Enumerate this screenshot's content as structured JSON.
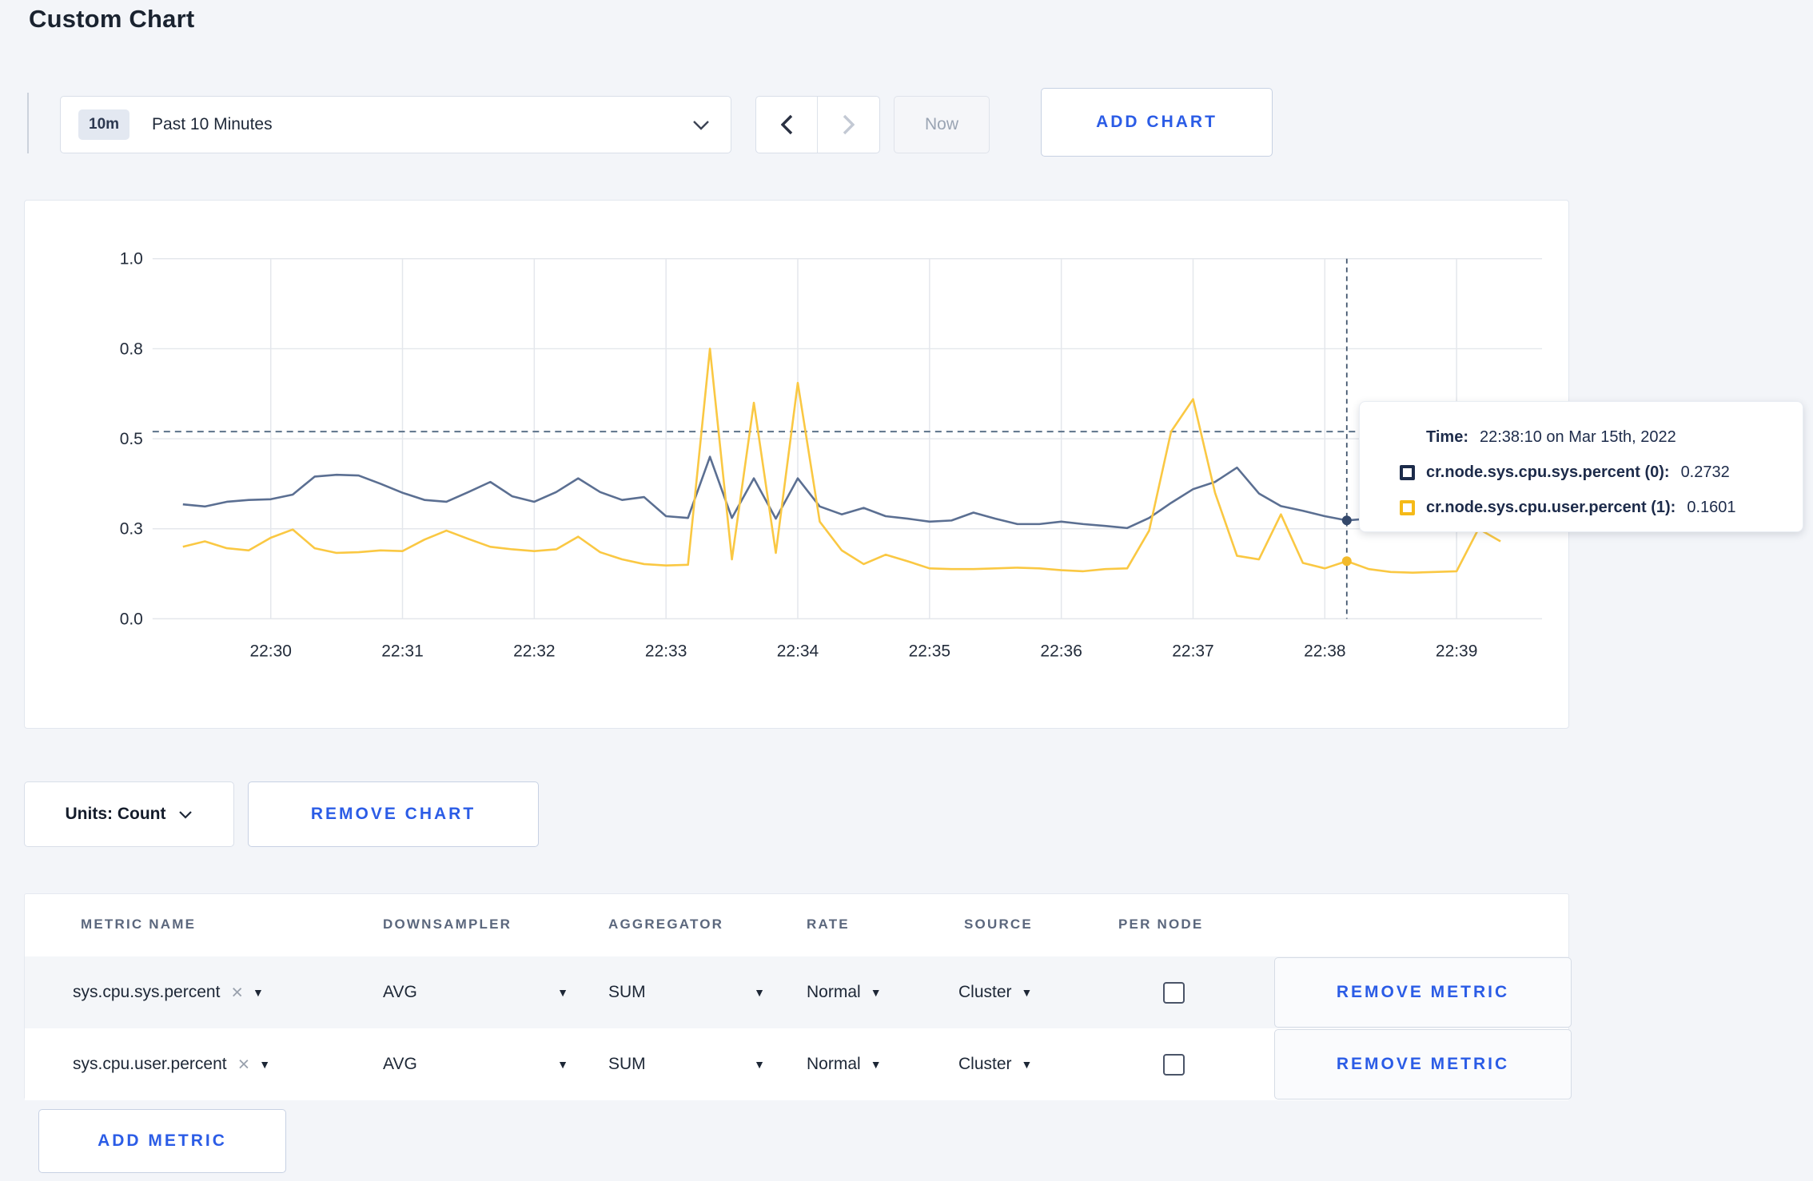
{
  "page": {
    "title": "Custom Chart",
    "background": "#f3f5f9",
    "accent_blue": "#2b5ce6"
  },
  "toolbar": {
    "time_range": {
      "badge": "10m",
      "label": "Past 10 Minutes"
    },
    "now_label": "Now",
    "add_chart_label": "ADD CHART",
    "icons": {
      "prev": "chevron-left",
      "next": "chevron-right",
      "open": "chevron-down"
    },
    "prev_enabled": true,
    "next_enabled": false
  },
  "chart_data": {
    "type": "line",
    "title": "",
    "xlabel": "",
    "ylabel": "",
    "ylim": [
      0,
      1
    ],
    "grid": true,
    "y_ticks": {
      "values": [
        0,
        0.25,
        0.5,
        0.75,
        1.0
      ],
      "labels": [
        "0.0",
        "0.3",
        "0.5",
        "0.8",
        "1.0"
      ]
    },
    "x_labels": [
      "22:30",
      "22:31",
      "22:32",
      "22:33",
      "22:34",
      "22:35",
      "22:36",
      "22:37",
      "22:38",
      "22:39"
    ],
    "x_times": [
      "22:29:20",
      "22:29:30",
      "22:29:40",
      "22:29:50",
      "22:30:00",
      "22:30:10",
      "22:30:20",
      "22:30:30",
      "22:30:40",
      "22:30:50",
      "22:31:00",
      "22:31:10",
      "22:31:20",
      "22:31:30",
      "22:31:40",
      "22:31:50",
      "22:32:00",
      "22:32:10",
      "22:32:20",
      "22:32:30",
      "22:32:40",
      "22:32:50",
      "22:33:00",
      "22:33:10",
      "22:33:20",
      "22:33:30",
      "22:33:40",
      "22:33:50",
      "22:34:00",
      "22:34:10",
      "22:34:20",
      "22:34:30",
      "22:34:40",
      "22:34:50",
      "22:35:00",
      "22:35:10",
      "22:35:20",
      "22:35:30",
      "22:35:40",
      "22:35:50",
      "22:36:00",
      "22:36:10",
      "22:36:20",
      "22:36:30",
      "22:36:40",
      "22:36:50",
      "22:37:00",
      "22:37:10",
      "22:37:20",
      "22:37:30",
      "22:37:40",
      "22:37:50",
      "22:38:00",
      "22:38:10",
      "22:38:20",
      "22:38:30",
      "22:38:40",
      "22:38:50",
      "22:39:00",
      "22:39:10",
      "22:39:20"
    ],
    "series": [
      {
        "name": "cr.node.sys.cpu.sys.percent (0)",
        "color": "#5b6f92",
        "swatch_color": "#1c2b4a",
        "dot_color": "#34486b",
        "values": [
          0.318,
          0.312,
          0.325,
          0.33,
          0.332,
          0.345,
          0.395,
          0.4,
          0.398,
          0.375,
          0.35,
          0.33,
          0.325,
          0.352,
          0.38,
          0.34,
          0.325,
          0.352,
          0.39,
          0.352,
          0.33,
          0.338,
          0.285,
          0.28,
          0.45,
          0.28,
          0.39,
          0.278,
          0.39,
          0.312,
          0.29,
          0.308,
          0.285,
          0.278,
          0.27,
          0.273,
          0.295,
          0.278,
          0.263,
          0.263,
          0.27,
          0.263,
          0.258,
          0.252,
          0.28,
          0.322,
          0.36,
          0.38,
          0.42,
          0.348,
          0.313,
          0.3,
          0.285,
          0.2732,
          0.278,
          0.275,
          0.272,
          0.28,
          0.295,
          0.282,
          0.29
        ]
      },
      {
        "name": "cr.node.sys.cpu.user.percent (1)",
        "color": "#fac843",
        "swatch_color": "#f5ba18",
        "dot_color": "#f3ba2a",
        "values": [
          0.2,
          0.215,
          0.196,
          0.19,
          0.225,
          0.248,
          0.196,
          0.183,
          0.185,
          0.19,
          0.188,
          0.22,
          0.245,
          0.222,
          0.2,
          0.193,
          0.188,
          0.193,
          0.228,
          0.185,
          0.165,
          0.152,
          0.148,
          0.15,
          0.75,
          0.165,
          0.6,
          0.183,
          0.655,
          0.27,
          0.19,
          0.152,
          0.178,
          0.16,
          0.14,
          0.138,
          0.138,
          0.14,
          0.142,
          0.14,
          0.135,
          0.132,
          0.138,
          0.14,
          0.245,
          0.52,
          0.61,
          0.35,
          0.175,
          0.165,
          0.29,
          0.155,
          0.14,
          0.1601,
          0.138,
          0.13,
          0.128,
          0.13,
          0.132,
          0.25,
          0.215
        ]
      }
    ],
    "dashed_line_value": 0.52,
    "hover_index": 53,
    "legend_position": "tooltip"
  },
  "tooltip": {
    "time_label": "Time:",
    "time_value": "22:38:10 on Mar 15th, 2022",
    "rows": [
      {
        "name": "cr.node.sys.cpu.sys.percent (0):",
        "value": "0.2732"
      },
      {
        "name": "cr.node.sys.cpu.user.percent (1):",
        "value": "0.1601"
      }
    ]
  },
  "units": {
    "label": "Units: Count"
  },
  "remove_chart_label": "REMOVE CHART",
  "metrics_table": {
    "headers": [
      "METRIC NAME",
      "DOWNSAMPLER",
      "AGGREGATOR",
      "RATE",
      "SOURCE",
      "PER NODE"
    ],
    "rows": [
      {
        "metric": "sys.cpu.sys.percent",
        "downsampler": "AVG",
        "aggregator": "SUM",
        "rate": "Normal",
        "source": "Cluster",
        "per_node_checked": false,
        "remove_label": "REMOVE METRIC"
      },
      {
        "metric": "sys.cpu.user.percent",
        "downsampler": "AVG",
        "aggregator": "SUM",
        "rate": "Normal",
        "source": "Cluster",
        "per_node_checked": false,
        "remove_label": "REMOVE METRIC"
      }
    ],
    "add_metric_label": "ADD METRIC"
  }
}
